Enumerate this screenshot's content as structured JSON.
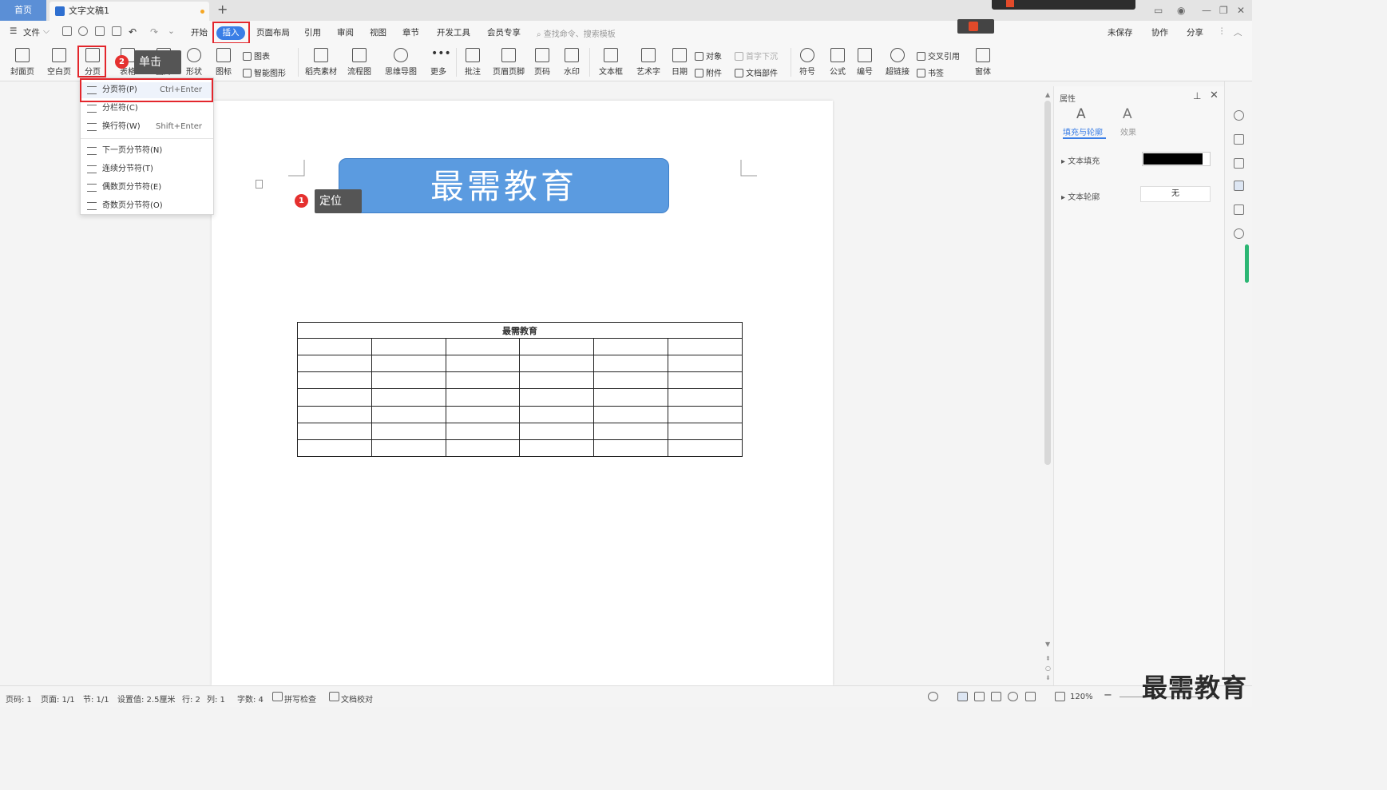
{
  "titlebar": {
    "home_tab": "首页",
    "doc_tab": "文字文稿1",
    "new_tab": "+"
  },
  "menubar": {
    "file": "文件",
    "tabs": [
      "开始",
      "插入",
      "页面布局",
      "引用",
      "审阅",
      "视图",
      "章节",
      "开发工具",
      "会员专享"
    ],
    "search_placeholder": "查找命令、搜索模板",
    "unsaved": "未保存",
    "collab": "协作",
    "share": "分享"
  },
  "ribbon": {
    "cover": "封面页",
    "blank": "空白页",
    "page_break": "分页",
    "table": "表格",
    "picture": "图片",
    "shape": "形状",
    "icon": "图标",
    "chart": "图表",
    "smart_art": "智能图形",
    "material": "稻壳素材",
    "flowchart": "流程图",
    "mindmap": "思维导图",
    "more": "更多",
    "comment": "批注",
    "header_footer": "页眉页脚",
    "page_number": "页码",
    "watermark": "水印",
    "textbox": "文本框",
    "wordart": "艺术字",
    "date": "日期",
    "object": "对象",
    "drop_cap": "首字下沉",
    "attachment": "附件",
    "doc_parts": "文档部件",
    "symbol": "符号",
    "formula": "公式",
    "numbering": "编号",
    "hyperlink": "超链接",
    "cross_ref": "交叉引用",
    "bookmark": "书签",
    "window": "窗体"
  },
  "dropdown": {
    "items": [
      {
        "label": "分页符(P)",
        "shortcut": "Ctrl+Enter"
      },
      {
        "label": "分栏符(C)",
        "shortcut": ""
      },
      {
        "label": "换行符(W)",
        "shortcut": "Shift+Enter"
      },
      {
        "label": "下一页分节符(N)",
        "shortcut": ""
      },
      {
        "label": "连续分节符(T)",
        "shortcut": ""
      },
      {
        "label": "偶数页分节符(E)",
        "shortcut": ""
      },
      {
        "label": "奇数页分节符(O)",
        "shortcut": ""
      }
    ]
  },
  "callouts": {
    "click": {
      "num": "2",
      "text": "单击"
    },
    "locate": {
      "num": "1",
      "text": "定位"
    }
  },
  "document": {
    "banner_text": "最需教育",
    "table_header": "最需教育",
    "table_rows": 7,
    "table_cols": 6
  },
  "panel": {
    "title": "属性",
    "tab_fill": "填充与轮廓",
    "tab_effect": "效果",
    "text_fill": "文本填充",
    "text_outline": "文本轮廓",
    "outline_value": "无"
  },
  "statusbar": {
    "page_num": "页码: 1",
    "pages": "页面: 1/1",
    "section": "节: 1/1",
    "setting": "设置值: 2.5厘米",
    "row": "行: 2",
    "col": "列: 1",
    "words": "字数: 4",
    "spellcheck": "拼写检查",
    "doc_check": "文档校对",
    "zoom": "120%"
  },
  "watermark": "最需教育",
  "colors": {
    "accent": "#3a7ee6",
    "highlight_red": "#e3262c",
    "banner_fill": "#5b9be0",
    "green": "#2bb673"
  }
}
